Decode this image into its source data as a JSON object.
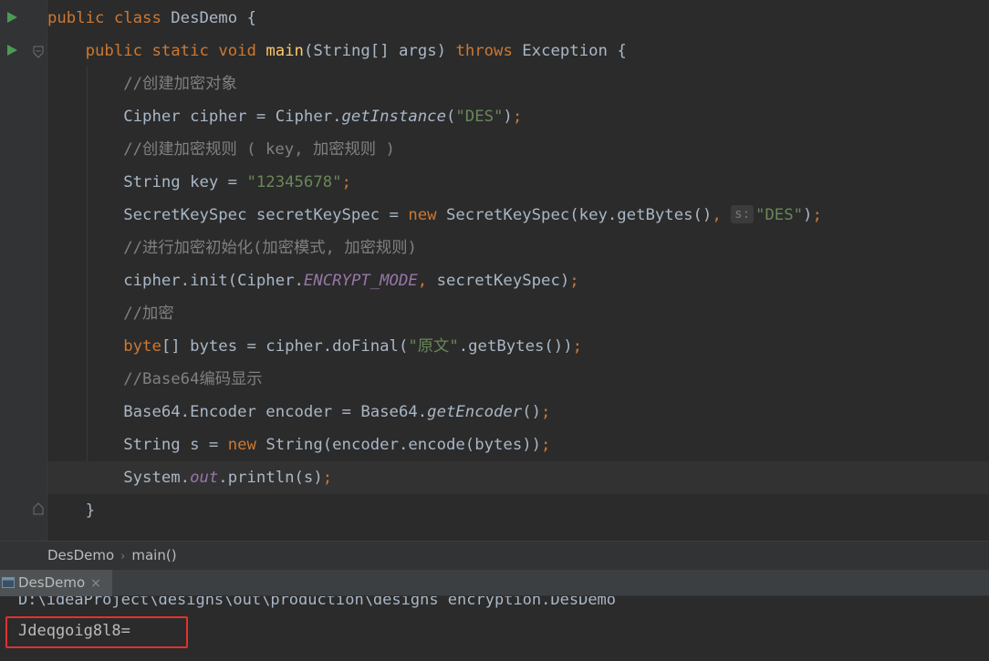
{
  "editor": {
    "lines": [
      [
        {
          "t": "public ",
          "c": "kw"
        },
        {
          "t": "class ",
          "c": "kw"
        },
        {
          "t": "DesDemo {",
          "c": ""
        }
      ],
      [
        {
          "t": "    ",
          "c": ""
        },
        {
          "t": "public ",
          "c": "kw"
        },
        {
          "t": "static ",
          "c": "kw"
        },
        {
          "t": "void ",
          "c": "kw"
        },
        {
          "t": "main",
          "c": "fn"
        },
        {
          "t": "(String[] args) ",
          "c": ""
        },
        {
          "t": "throws ",
          "c": "kw"
        },
        {
          "t": "Exception {",
          "c": ""
        }
      ],
      [
        {
          "t": "        ",
          "c": ""
        },
        {
          "t": "//创建加密对象",
          "c": "cmt"
        }
      ],
      [
        {
          "t": "        ",
          "c": ""
        },
        {
          "t": "Cipher cipher = Cipher.",
          "c": ""
        },
        {
          "t": "getInstance",
          "c": "ital"
        },
        {
          "t": "(",
          "c": ""
        },
        {
          "t": "\"DES\"",
          "c": "str"
        },
        {
          "t": ")",
          "c": ""
        },
        {
          "t": ";",
          "c": "kw"
        }
      ],
      [
        {
          "t": "        ",
          "c": ""
        },
        {
          "t": "//创建加密规则 ( key, 加密规则 )",
          "c": "cmt"
        }
      ],
      [
        {
          "t": "        ",
          "c": ""
        },
        {
          "t": "String key = ",
          "c": ""
        },
        {
          "t": "\"12345678\"",
          "c": "str"
        },
        {
          "t": ";",
          "c": "kw"
        }
      ],
      [
        {
          "t": "        ",
          "c": ""
        },
        {
          "t": "SecretKeySpec secretKeySpec = ",
          "c": ""
        },
        {
          "t": "new ",
          "c": "kw"
        },
        {
          "t": "SecretKeySpec(key.getBytes()",
          "c": ""
        },
        {
          "t": ", ",
          "c": "kw"
        },
        {
          "t": "s:",
          "c": "hint"
        },
        {
          "t": "\"DES\"",
          "c": "str"
        },
        {
          "t": ")",
          "c": ""
        },
        {
          "t": ";",
          "c": "kw"
        }
      ],
      [
        {
          "t": "        ",
          "c": ""
        },
        {
          "t": "//进行加密初始化(加密模式, 加密规则)",
          "c": "cmt"
        }
      ],
      [
        {
          "t": "        ",
          "c": ""
        },
        {
          "t": "cipher.init(Cipher.",
          "c": ""
        },
        {
          "t": "ENCRYPT_MODE",
          "c": "static-f"
        },
        {
          "t": ", ",
          "c": "kw"
        },
        {
          "t": "secretKeySpec)",
          "c": ""
        },
        {
          "t": ";",
          "c": "kw"
        }
      ],
      [
        {
          "t": "        ",
          "c": ""
        },
        {
          "t": "//加密",
          "c": "cmt"
        }
      ],
      [
        {
          "t": "        ",
          "c": ""
        },
        {
          "t": "byte",
          "c": "kw"
        },
        {
          "t": "[] bytes = cipher.doFinal(",
          "c": ""
        },
        {
          "t": "\"原文\"",
          "c": "str"
        },
        {
          "t": ".getBytes())",
          "c": ""
        },
        {
          "t": ";",
          "c": "kw"
        }
      ],
      [
        {
          "t": "        ",
          "c": ""
        },
        {
          "t": "//Base64编码显示",
          "c": "cmt"
        }
      ],
      [
        {
          "t": "        ",
          "c": ""
        },
        {
          "t": "Base64.Encoder encoder = Base64.",
          "c": ""
        },
        {
          "t": "getEncoder",
          "c": "ital"
        },
        {
          "t": "()",
          "c": ""
        },
        {
          "t": ";",
          "c": "kw"
        }
      ],
      [
        {
          "t": "        ",
          "c": ""
        },
        {
          "t": "String s = ",
          "c": ""
        },
        {
          "t": "new ",
          "c": "kw"
        },
        {
          "t": "String(encoder.encode(bytes))",
          "c": ""
        },
        {
          "t": ";",
          "c": "kw"
        }
      ],
      [
        {
          "t": "        ",
          "c": ""
        },
        {
          "t": "System.",
          "c": ""
        },
        {
          "t": "out",
          "c": "static-f"
        },
        {
          "t": ".println(s)",
          "c": ""
        },
        {
          "t": ";",
          "c": "kw"
        }
      ],
      [
        {
          "t": "    ",
          "c": ""
        },
        {
          "t": "}",
          "c": ""
        }
      ]
    ]
  },
  "breadcrumb": {
    "class_name": "DesDemo",
    "method_name": "main()"
  },
  "run_panel": {
    "tab_label": "DesDemo",
    "close_glyph": "×",
    "command_line": "D:\\ideaProject\\designs\\out\\production\\designs encryption.DesDemo",
    "output": "Jdeqgoig8l8="
  },
  "colors": {
    "keyword": "#cc7832",
    "string": "#6a8759",
    "comment": "#808080",
    "method_decl": "#ffc66d",
    "static_field": "#9876aa",
    "highlight_box": "#e03131"
  }
}
